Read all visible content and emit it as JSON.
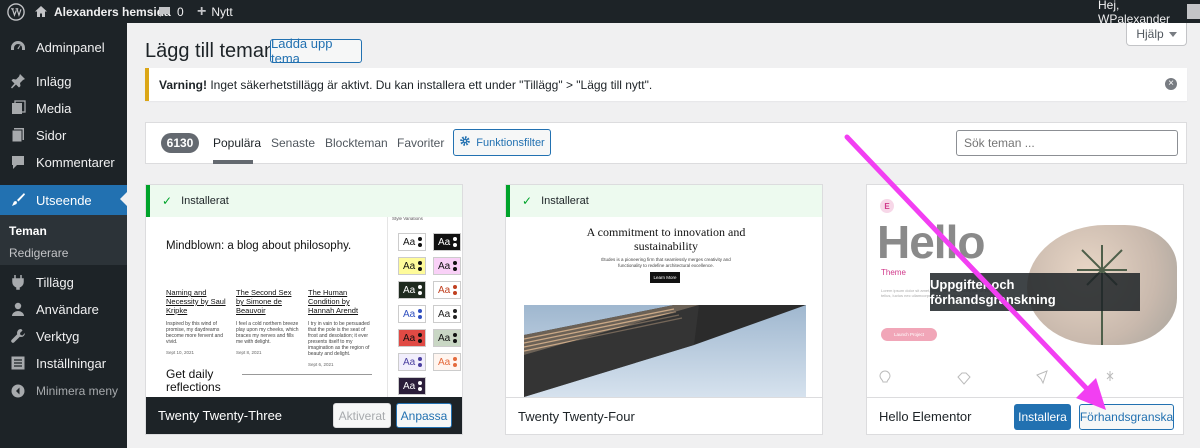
{
  "adminbar": {
    "site_name": "Alexanders hemsida",
    "comments_count": "0",
    "new_label": "Nytt",
    "greeting": "Hej, WPalexander"
  },
  "sidebar": {
    "items": [
      {
        "label": "Adminpanel",
        "icon": "dashboard-icon"
      },
      {
        "label": "Inlägg",
        "icon": "pin-icon"
      },
      {
        "label": "Media",
        "icon": "media-icon"
      },
      {
        "label": "Sidor",
        "icon": "page-icon"
      },
      {
        "label": "Kommentarer",
        "icon": "comment-icon"
      },
      {
        "label": "Utseende",
        "icon": "brush-icon",
        "active": true
      },
      {
        "label": "Tillägg",
        "icon": "plugin-icon"
      },
      {
        "label": "Användare",
        "icon": "user-icon"
      },
      {
        "label": "Verktyg",
        "icon": "wrench-icon"
      },
      {
        "label": "Inställningar",
        "icon": "settings-icon"
      },
      {
        "label": "Minimera meny",
        "icon": "collapse-icon"
      }
    ],
    "submenu": [
      "Teman",
      "Redigerare"
    ]
  },
  "page": {
    "title": "Lägg till teman",
    "upload_button": "Ladda upp tema",
    "help_button": "Hjälp"
  },
  "notice": {
    "bold": "Varning!",
    "text": " Inget säkerhetstillägg är aktivt. Du kan installera ett under \"Tillägg\" > \"Lägg till nytt\"."
  },
  "filter": {
    "count": "6130",
    "tabs": [
      "Populära",
      "Senaste",
      "Blockteman",
      "Favoriter"
    ],
    "feature_filter": "Funktionsfilter",
    "search_placeholder": "Sök teman ..."
  },
  "themes": [
    {
      "name": "Twenty Twenty-Three",
      "installed_label": "Installerat",
      "activated_label": "Aktiverat",
      "customize_label": "Anpassa",
      "preview": {
        "headline": "Mindblown: a blog about philosophy.",
        "styles_label": "Style Variations",
        "posts": [
          {
            "title": "Naming and Necessity by Saul Kripke",
            "desc": "Inspired by this wind of promise, my daydreams become more fervent and vivid.",
            "date": "Sept 10, 2021"
          },
          {
            "title": "The Second Sex by Simone de Beauvoir",
            "desc": "I feel a cold northern breeze play upon my cheeks, which braces my nerves and fills me with delight.",
            "date": "Sept 8, 2021"
          },
          {
            "title": "The Human Condition by Hannah Arendt",
            "desc": "I try in vain to be persuaded that the pole is the seat of frost and desolation; it ever presents itself to my imagination as the region of beauty and delight.",
            "date": "Sept 6, 2021"
          }
        ],
        "cta": "Get daily reflections",
        "swatch_label": "Aa"
      }
    },
    {
      "name": "Twenty Twenty-Four",
      "installed_label": "Installerat",
      "preview": {
        "headline": "A commitment to innovation and sustainability",
        "sub": "Études is a pioneering firm that seamlessly merges creativity and functionality to redefine architectural excellence.",
        "button": "Learn More"
      }
    },
    {
      "name": "Hello Elementor",
      "install_label": "Installera",
      "preview_label": "Förhandsgranska",
      "overlay_label": "Uppgifter och förhandsgranskning",
      "preview": {
        "hero": "Hello",
        "sub": "Theme",
        "lorem": "Lorem ipsum dolor sit amet, consectetur adipiscing elit. Ut elit tellus, luctus nec ullamcorper mattis, pulvinar dapibus leo.",
        "button": "Launch Project",
        "logo": "E"
      }
    }
  ],
  "colors": {
    "admin_dark": "#1d2327",
    "wp_blue": "#2271b1",
    "annotation_arrow": "#f23ff2",
    "installed_green": "#00a32a",
    "warning_yellow": "#dba617"
  }
}
